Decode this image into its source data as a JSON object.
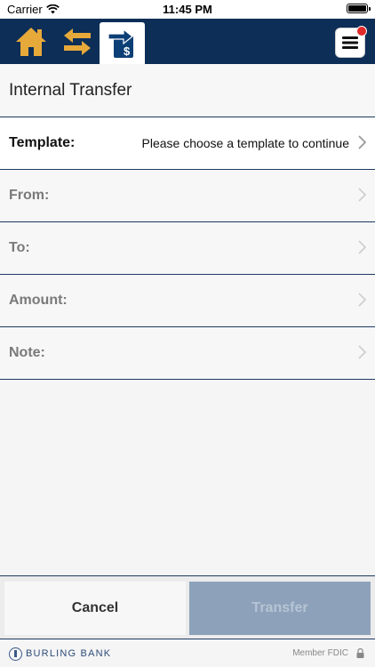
{
  "status_bar": {
    "carrier": "Carrier",
    "time": "11:45 PM"
  },
  "nav": {
    "home_icon": "home-icon",
    "swap_icon": "swap-arrows-icon",
    "transfer_icon": "transfer-dollar-icon",
    "menu_icon": "hamburger-menu-icon",
    "accent_color": "#e6a93a",
    "bar_color": "#0c2e57",
    "badge_color": "#e12b2b"
  },
  "page": {
    "title": "Internal Transfer"
  },
  "form": {
    "template_label": "Template:",
    "template_value": "Please choose a template to continue",
    "from_label": "From:",
    "to_label": "To:",
    "amount_label": "Amount:",
    "note_label": "Note:"
  },
  "actions": {
    "cancel_label": "Cancel",
    "transfer_label": "Transfer"
  },
  "footer": {
    "bank_name": "BURLING BANK",
    "fdic_text": "Member FDIC"
  }
}
